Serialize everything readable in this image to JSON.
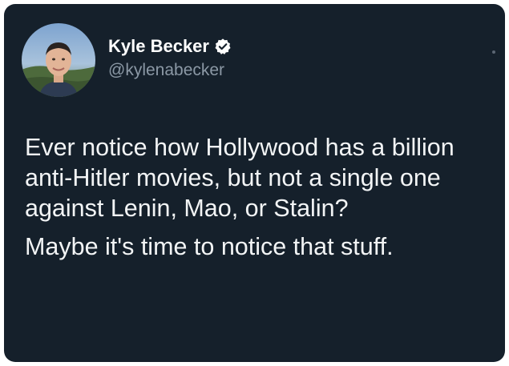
{
  "tweet": {
    "author": {
      "display_name": "Kyle Becker",
      "handle": "@kylenabecker",
      "verified": true,
      "avatar_icon": "profile-photo"
    },
    "paragraphs": [
      "Ever notice how Hollywood has a billion anti-Hitler movies, but not a single one against Lenin, Mao, or Stalin?",
      "Maybe it's time to notice that stuff."
    ]
  },
  "colors": {
    "card_background": "#15202b",
    "text_primary": "#ffffff",
    "text_secondary": "#8b98a5",
    "verified_badge": "#ffffff"
  }
}
